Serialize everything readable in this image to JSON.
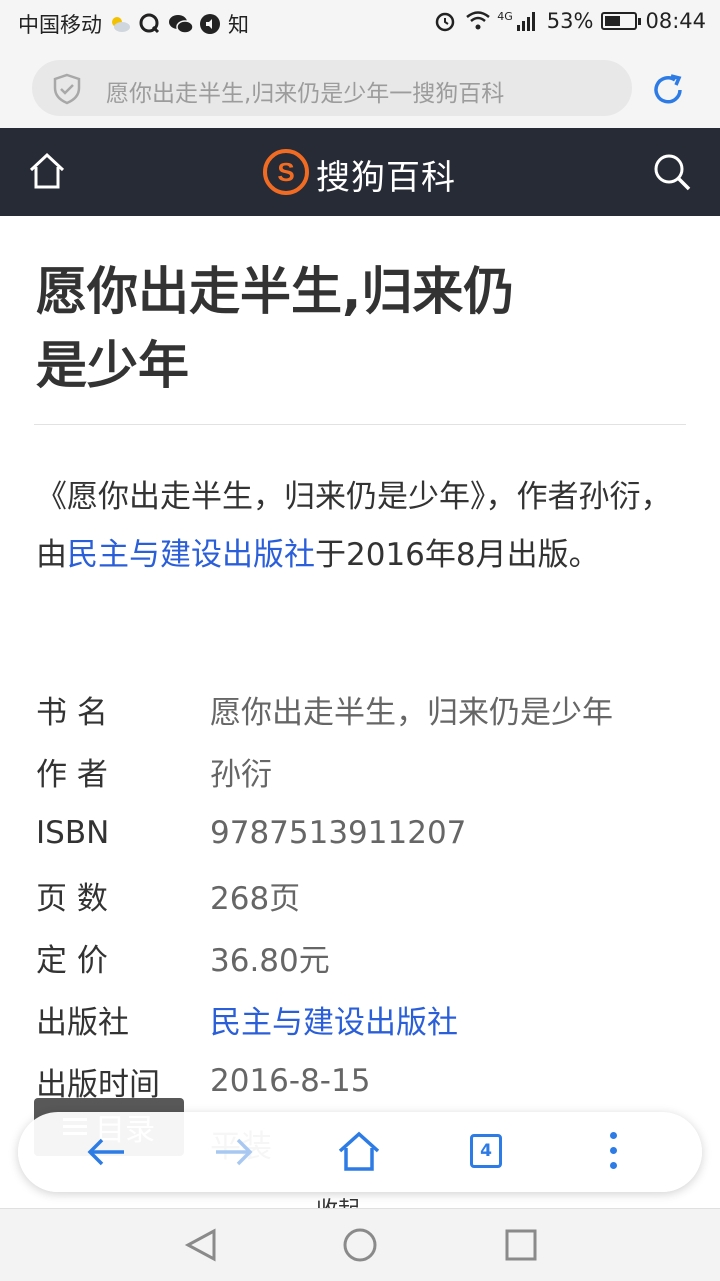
{
  "status_bar": {
    "carrier": "中国移动",
    "extra_icon_label": "知",
    "network": "4G",
    "battery": "53%",
    "battery_level": 0.53,
    "time": "08:44"
  },
  "address_bar": {
    "url_text": "愿你出走半生,归来仍是少年一搜狗百科"
  },
  "site_header": {
    "brand": "搜狗百科",
    "logo_letter": "S"
  },
  "article": {
    "title": "愿你出走半生,归来仍是少年",
    "summary": {
      "before": "《愿你出走半生，归来仍是少年》，作者孙衍，由",
      "link": "民主与建设出版社",
      "after": "于2016年8月出版。"
    },
    "info": [
      {
        "key": "书 名",
        "value": "愿你出走半生，归来仍是少年"
      },
      {
        "key": "作 者",
        "value": "孙衍"
      },
      {
        "key": "ISBN",
        "value": "9787513911207"
      },
      {
        "key": "页 数",
        "value": "268页"
      },
      {
        "key": "定 价",
        "value": "36.80元"
      },
      {
        "key": "出版社",
        "value": "民主与建设出版社"
      },
      {
        "key": "出版时间",
        "value": "2016-8-15"
      },
      {
        "key": "",
        "value": "平装"
      }
    ],
    "toc_button": "目录",
    "collapse_text": "收起"
  },
  "browser_toolbar": {
    "tab_count": "4"
  },
  "colors": {
    "header_bg": "#262b36",
    "link": "#2b5fd9",
    "accent": "#2d7be5",
    "logo_orange": "#f26b22"
  }
}
